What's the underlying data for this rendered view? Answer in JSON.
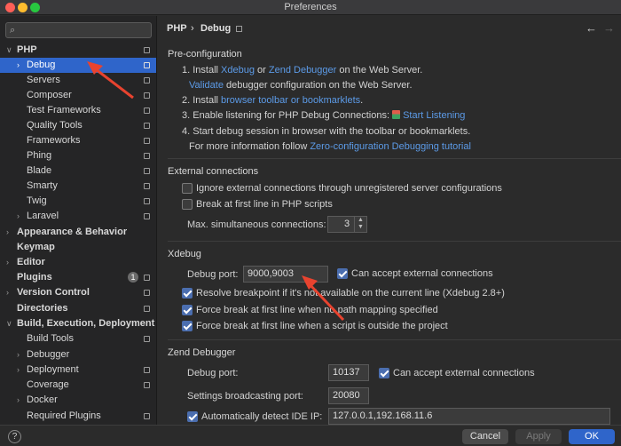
{
  "window": {
    "title": "Preferences"
  },
  "search": {
    "placeholder": ""
  },
  "sidebar": {
    "items": [
      {
        "label": "PHP",
        "expanded": true
      },
      {
        "label": "Debug",
        "selected": true
      },
      {
        "label": "Servers"
      },
      {
        "label": "Composer"
      },
      {
        "label": "Test Frameworks"
      },
      {
        "label": "Quality Tools"
      },
      {
        "label": "Frameworks"
      },
      {
        "label": "Phing"
      },
      {
        "label": "Blade"
      },
      {
        "label": "Smarty"
      },
      {
        "label": "Twig"
      },
      {
        "label": "Laravel"
      },
      {
        "label": "Appearance & Behavior"
      },
      {
        "label": "Keymap"
      },
      {
        "label": "Editor"
      },
      {
        "label": "Plugins",
        "badge": "1"
      },
      {
        "label": "Version Control"
      },
      {
        "label": "Directories"
      },
      {
        "label": "Build, Execution, Deployment"
      },
      {
        "label": "Build Tools"
      },
      {
        "label": "Debugger"
      },
      {
        "label": "Deployment"
      },
      {
        "label": "Coverage"
      },
      {
        "label": "Docker"
      },
      {
        "label": "Required Plugins"
      }
    ]
  },
  "breadcrumb": {
    "parent": "PHP",
    "separator": "›",
    "current": "Debug"
  },
  "preconfig": {
    "title": "Pre-configuration",
    "l1_prefix": "1. Install ",
    "l1_link1": "Xdebug",
    "l1_mid": " or ",
    "l1_link2": "Zend Debugger",
    "l1_suffix": " on the Web Server.",
    "l1b_link": "Validate",
    "l1b_suffix": " debugger configuration on the Web Server.",
    "l2_prefix": "2. Install ",
    "l2_link": "browser toolbar or bookmarklets",
    "l2_suffix": ".",
    "l3_prefix": "3. Enable listening for PHP Debug Connections: ",
    "l3_link": "Start Listening",
    "l4": "4. Start debug session in browser with the toolbar or bookmarklets.",
    "l4b_prefix": "For more information follow ",
    "l4b_link": "Zero-configuration Debugging tutorial"
  },
  "external": {
    "title": "External connections",
    "ignore_label": "Ignore external connections through unregistered server configurations",
    "ignore_checked": false,
    "break_label": "Break at first line in PHP scripts",
    "break_checked": false,
    "max_label": "Max. simultaneous connections:",
    "max_value": "3"
  },
  "xdebug": {
    "title": "Xdebug",
    "port_label": "Debug port:",
    "port_value": "9000,9003",
    "accept_label": "Can accept external connections",
    "accept_checked": true,
    "resolve_label": "Resolve breakpoint if it's not available on the current line (Xdebug 2.8+)",
    "force_nopath_label": "Force break at first line when no path mapping specified",
    "force_outside_label": "Force break at first line when a script is outside the project"
  },
  "zend": {
    "title": "Zend Debugger",
    "port_label": "Debug port:",
    "port_value": "10137",
    "accept_label": "Can accept external connections",
    "broadcast_label": "Settings broadcasting port:",
    "broadcast_value": "20080",
    "detect_label": "Automatically detect IDE IP:",
    "detect_value": "127.0.0.1,192.168.11.6"
  },
  "buttons": {
    "help": "?",
    "cancel": "Cancel",
    "apply": "Apply",
    "ok": "OK"
  },
  "colors": {
    "accent": "#2f65ca",
    "link": "#5c9be8",
    "annotation_arrow": "#e8432f"
  }
}
